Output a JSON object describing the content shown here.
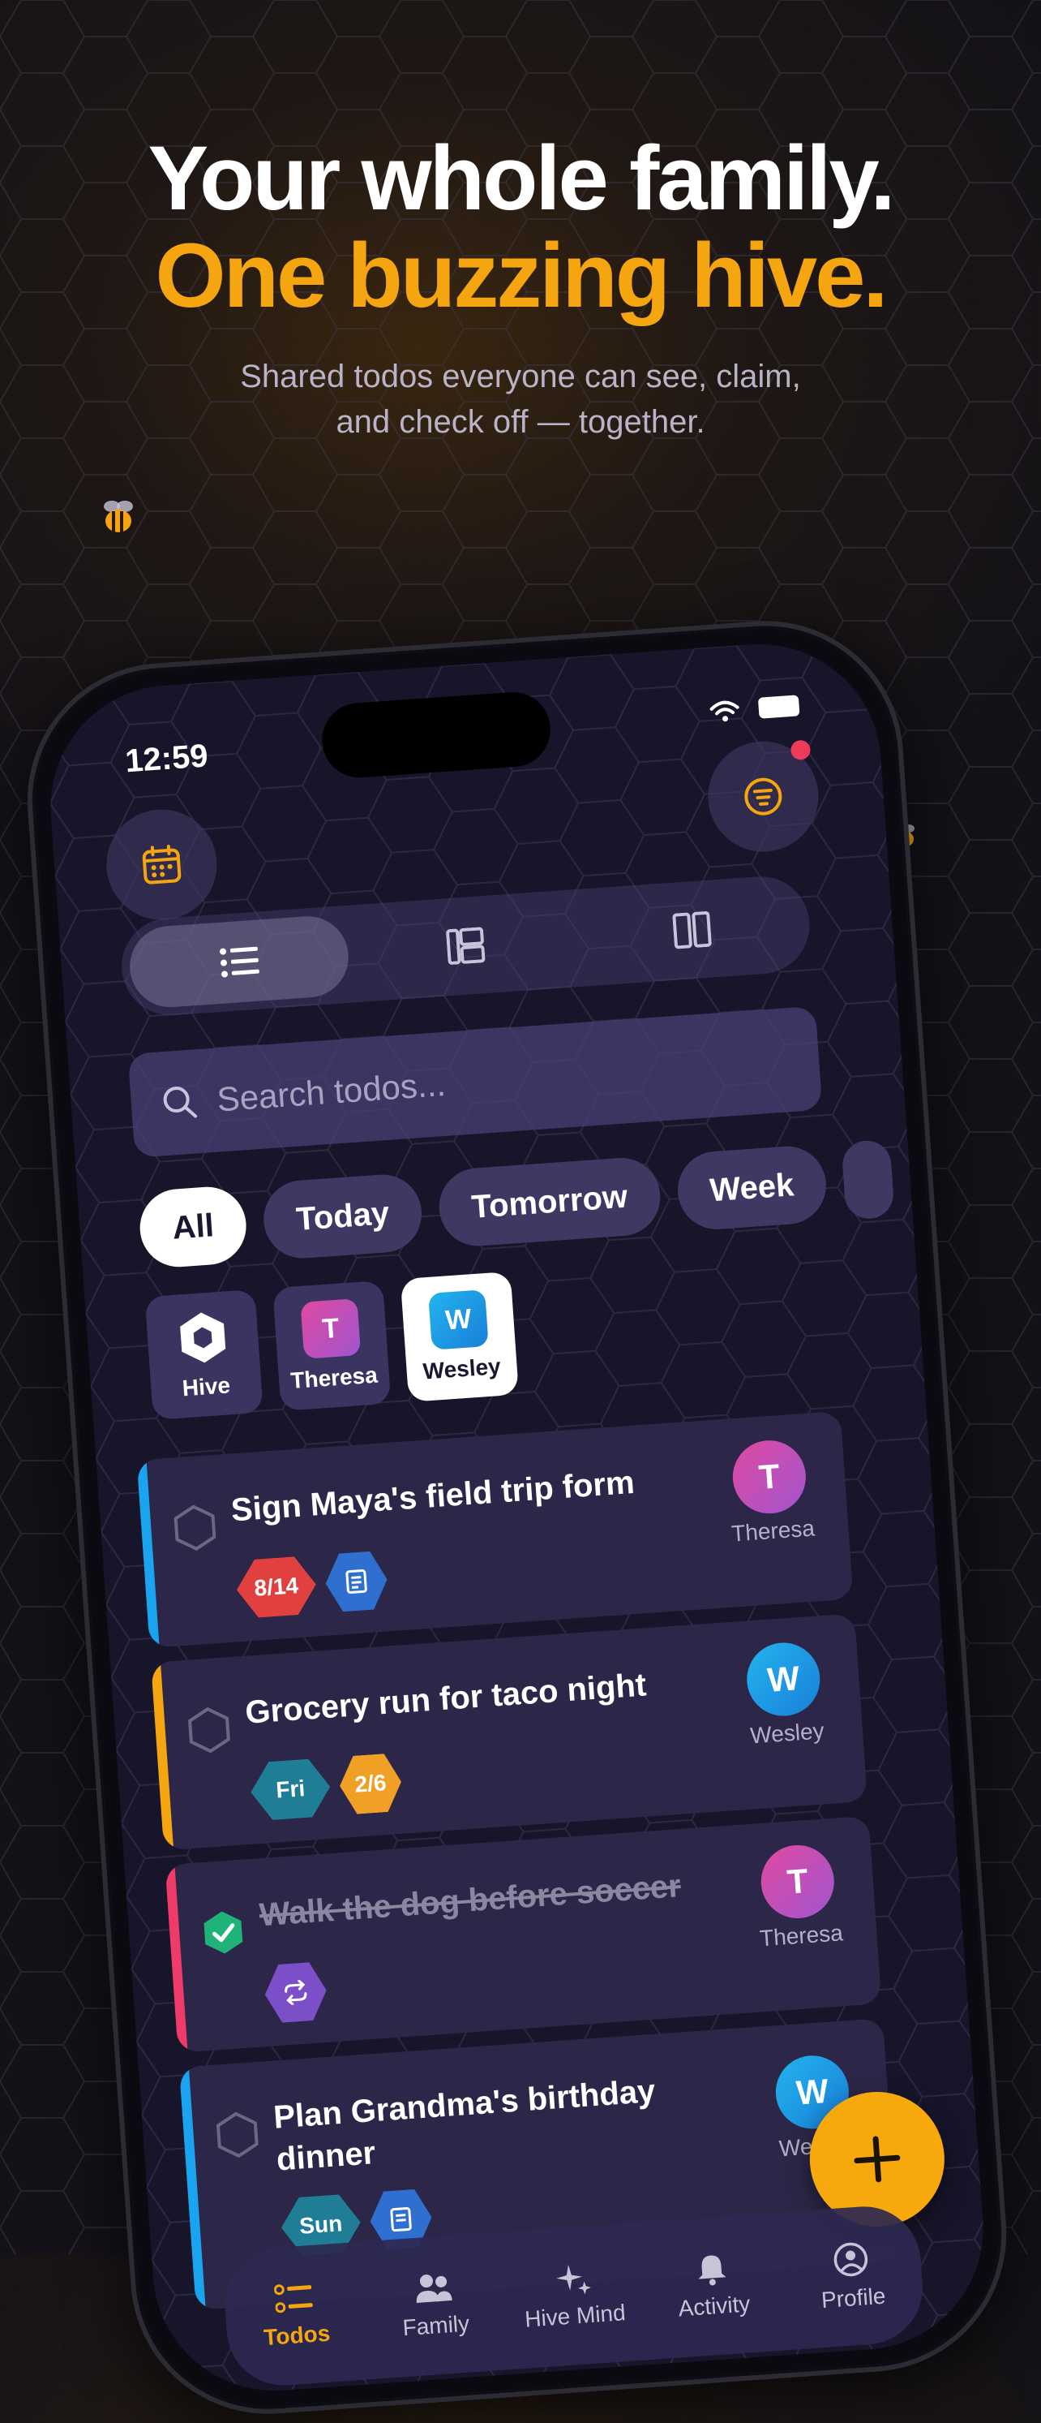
{
  "headline": {
    "line1": "Your whole family.",
    "line2": "One buzzing hive.",
    "subtitle_line1": "Shared todos everyone can see, claim,",
    "subtitle_line2": "and check off — together."
  },
  "status_bar": {
    "time": "12:59"
  },
  "colors": {
    "accent": "#f5a50f",
    "background": "#17152a",
    "card": "#2c2748"
  },
  "view_switcher": {
    "options": [
      "list-view",
      "board-view",
      "columns-view"
    ],
    "selected": "list-view"
  },
  "search": {
    "placeholder": "Search todos..."
  },
  "date_filters": {
    "items": [
      "All",
      "Today",
      "Tomorrow",
      "Week"
    ],
    "selected": "All"
  },
  "members": [
    {
      "label": "Hive",
      "initial": "",
      "color": "#ffffff"
    },
    {
      "label": "Theresa",
      "initial": "T",
      "color": "#d94fa0"
    },
    {
      "label": "Wesley",
      "initial": "W",
      "color": "#1a9fe0",
      "selected": true
    }
  ],
  "todos": [
    {
      "title": "Sign Maya's field trip form",
      "done": false,
      "stripe": "#1aa4ef",
      "tags": [
        {
          "text": "8/14",
          "color": "#e0413f"
        },
        {
          "text": "",
          "icon": "note-icon",
          "color": "#2f6fd0"
        }
      ],
      "assignee": {
        "name": "Theresa",
        "initial": "T",
        "color": "#d24fa6"
      }
    },
    {
      "title": "Grocery run for taco night",
      "done": false,
      "stripe": "#f5a50f",
      "tags": [
        {
          "text": "Fri",
          "color": "#1f7d95"
        },
        {
          "text": "2/6",
          "color": "#f0a024"
        }
      ],
      "assignee": {
        "name": "Wesley",
        "initial": "W",
        "color": "#1a9fe0"
      }
    },
    {
      "title": "Walk the dog before soccer",
      "done": true,
      "stripe": "#ef3b6a",
      "tags": [
        {
          "text": "",
          "icon": "repeat-icon",
          "color": "#7b4fc8"
        }
      ],
      "assignee": {
        "name": "Theresa",
        "initial": "T",
        "color": "#d24fa6"
      }
    },
    {
      "title": "Plan Grandma's birthday dinner",
      "done": false,
      "stripe": "#1aa4ef",
      "tags": [
        {
          "text": "Sun",
          "color": "#1f7d95"
        },
        {
          "text": "",
          "icon": "note-icon",
          "color": "#2f6fd0"
        }
      ],
      "assignee": {
        "name": "Wesley",
        "initial": "W",
        "color": "#1a9fe0"
      }
    }
  ],
  "tabbar": {
    "items": [
      {
        "label": "Todos",
        "icon": "todos-icon"
      },
      {
        "label": "Family",
        "icon": "family-icon"
      },
      {
        "label": "Hive Mind",
        "icon": "sparkle-icon"
      },
      {
        "label": "Activity",
        "icon": "bell-icon"
      },
      {
        "label": "Profile",
        "icon": "profile-icon"
      }
    ],
    "selected": "Todos"
  }
}
